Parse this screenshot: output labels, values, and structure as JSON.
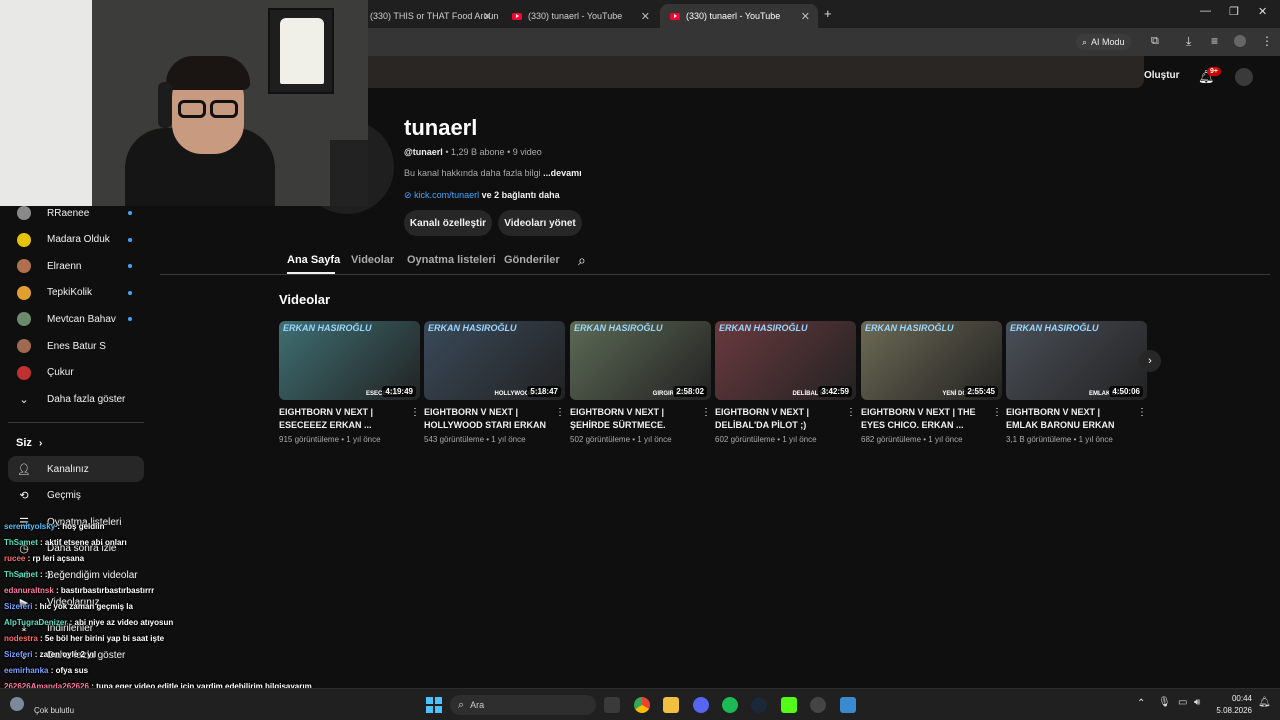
{
  "browser": {
    "tabs": [
      {
        "title": "(330) THIS or THAT Food Aroun",
        "active": false
      },
      {
        "title": "(330) tunaerl - YouTube",
        "active": false
      },
      {
        "title": "(330) tunaerl - YouTube",
        "active": true
      }
    ],
    "new_tab_glyph": "+",
    "close_glyph": "✕",
    "ai_mode_label": "AI Modu"
  },
  "header": {
    "create_label": "Oluştur",
    "notifications_badge": "9+"
  },
  "channel": {
    "name": "tunaerl",
    "handle": "@tunaerl",
    "subscribers": "1,29 B abone",
    "video_count": "9 video",
    "sep": "•",
    "about_text": "Bu kanal hakkında daha fazla bilgi",
    "about_more": "...devamı",
    "link_text": "kick.com/tunaerl",
    "link_more": "ve 2 bağlantı daha",
    "customize_button": "Kanalı özelleştir",
    "manage_button": "Videoları yönet"
  },
  "tabs": [
    "Ana Sayfa",
    "Videolar",
    "Oynatma listeleri",
    "Gönderiler"
  ],
  "section_title": "Videolar",
  "videos": [
    {
      "title": "EIGHTBORN V NEXT | ESECEEEZ ERKAN ...",
      "views": "915 görüntüleme",
      "age": "1 yıl önce",
      "duration": "4:19:49",
      "thumb_caption": "ESECEEEZ",
      "bg": "#3f6f73"
    },
    {
      "title": "EIGHTBORN V NEXT | HOLLYWOOD STARI ERKAN ...",
      "views": "543 görüntüleme",
      "age": "1 yıl önce",
      "duration": "5:18:47",
      "thumb_caption": "HOLLYWOOD ST",
      "bg": "#3a4a5a"
    },
    {
      "title": "EIGHTBORN V NEXT | ŞEHİRDE SÜRTMECE. ERKA...",
      "views": "502 görüntüleme",
      "age": "1 yıl önce",
      "duration": "2:58:02",
      "thumb_caption": "GIRGIR ŞAM",
      "bg": "#5d6a55"
    },
    {
      "title": "EIGHTBORN V NEXT | DELİBAL'DA PİLOT ;) ERKAN...",
      "views": "602 görüntüleme",
      "age": "1 yıl önce",
      "duration": "3:42:59",
      "thumb_caption": "DELİBAL'DA P",
      "bg": "#6a3a3f"
    },
    {
      "title": "EIGHTBORN V NEXT | THE EYES CHICO. ERKAN ...",
      "views": "682 görüntüleme",
      "age": "1 yıl önce",
      "duration": "2:55:45",
      "thumb_caption": "YENİ DÖVME",
      "bg": "#6d6a55"
    },
    {
      "title": "EIGHTBORN V NEXT | EMLAK BARONU ERKAN HASIROĞL...",
      "views": "3,1 B görüntüleme",
      "age": "1 yıl önce",
      "duration": "4:50:06",
      "thumb_caption": "EMLAK BAR",
      "bg": "#4a5058"
    }
  ],
  "thumb_brand": "ERKAN HASIROĞLU",
  "sidebar": {
    "subscriptions": [
      {
        "label": "RRaenee",
        "color": "#8a8a8a",
        "dot": true
      },
      {
        "label": "Madara Olduk",
        "color": "#e6c200",
        "dot": true
      },
      {
        "label": "Elraenn",
        "color": "#b07050",
        "dot": true
      },
      {
        "label": "TepkiKolik",
        "color": "#e0a030",
        "dot": true
      },
      {
        "label": "Mevtcan Bahav",
        "color": "#6a8a6a",
        "dot": true
      },
      {
        "label": "Enes Batur S",
        "color": "#a06a50",
        "dot": false
      },
      {
        "label": "Çukur",
        "color": "#c03030",
        "dot": false
      }
    ],
    "show_more": "Daha fazla göster",
    "you_heading": "Siz",
    "you_items": [
      "Kanalınız",
      "Geçmiş",
      "Oynatma listeleri",
      "Daha sonra izle",
      "Beğendiğim videolar",
      "Videolarınız",
      "İndirilenler",
      "Daha fazla göster"
    ]
  },
  "chat": [
    {
      "user": "serenityolsky",
      "msg": ": hoş geldiin",
      "color": "#4fc3ff"
    },
    {
      "user": "ThSamet",
      "msg": ": aktif etsene abi onları",
      "color": "#55e0c0"
    },
    {
      "user": "rucee",
      "msg": ": rp leri açsana",
      "color": "#ff6b6b"
    },
    {
      "user": "ThSamet",
      "msg": ": :)",
      "color": "#55e0c0"
    },
    {
      "user": "edanuraltnsk",
      "msg": ": bastırbastırbastırbastırrr",
      "color": "#ff7aa0"
    },
    {
      "user": "Sizeferi",
      "msg": ": hic yok zaman geçmiş la",
      "color": "#7aa0ff"
    },
    {
      "user": "AlpTugraDenizer",
      "msg": ": abi niye az video atıyosun",
      "color": "#55e0c0"
    },
    {
      "user": "nodestra",
      "msg": ": 5e böl her birini yap bi saat işte",
      "color": "#ff6b6b"
    },
    {
      "user": "Sizeferi",
      "msg": ": zaten oyle 2 yıl",
      "color": "#7aa0ff"
    },
    {
      "user": "eemirhanka",
      "msg": ": ofya sus",
      "color": "#7aa0ff"
    },
    {
      "user": "262626Amanda262626",
      "msg": ": tuna eger video editle icin yardim edebilirim bilgisayarım",
      "color": "#ff7aa0"
    },
    {
      "user": "gelince@tunaerl",
      "msg": "",
      "color": "#ffffff"
    }
  ],
  "taskbar": {
    "weather": "Çok bulutlu",
    "search_label": "Ara",
    "time": "00:44",
    "date": "5.08.2026"
  }
}
